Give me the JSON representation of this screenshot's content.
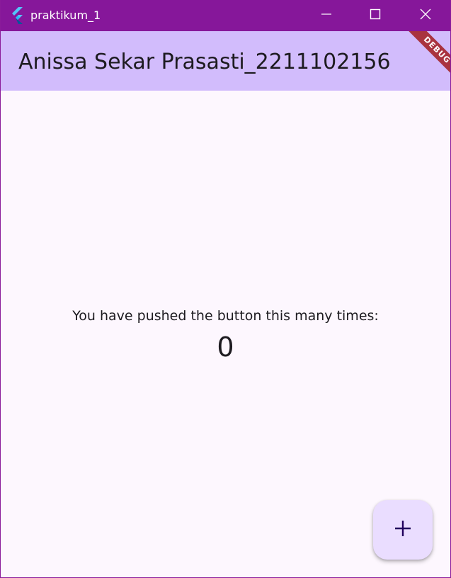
{
  "window": {
    "title": "praktikum_1",
    "controls": {
      "minimize_icon": "minimize-icon",
      "maximize_icon": "maximize-icon",
      "close_icon": "close-icon"
    },
    "accent_color": "#86179a"
  },
  "appbar": {
    "title": "Anissa Sekar Prasasti_2211102156",
    "background_color": "#d2bcfc"
  },
  "debug_banner": {
    "label": "DEBUG",
    "color": "#a9333f"
  },
  "body": {
    "counter_label": "You have pushed the button this many times:",
    "counter_value": "0"
  },
  "fab": {
    "icon": "plus-icon",
    "background_color": "#eaddff"
  }
}
